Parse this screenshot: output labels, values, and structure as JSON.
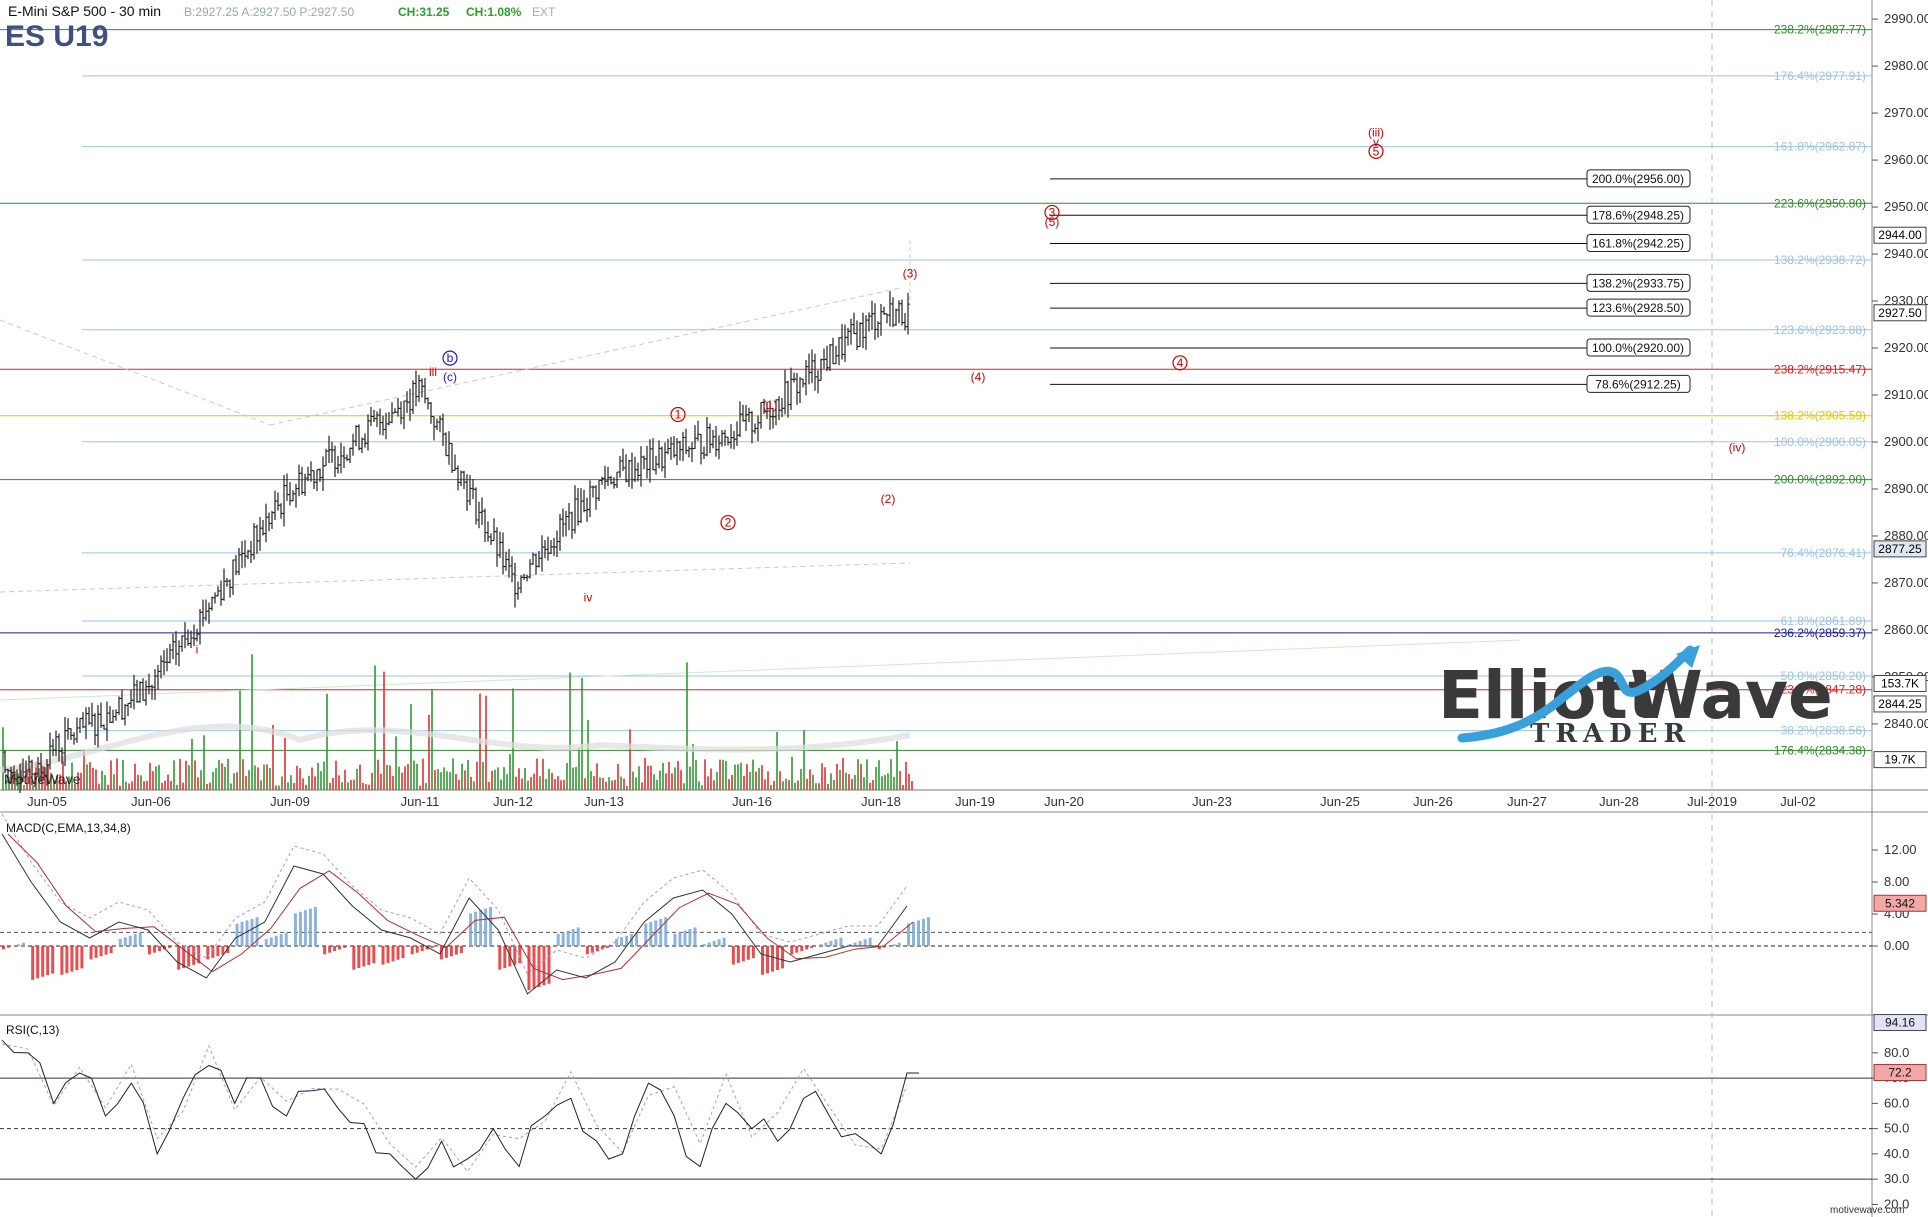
{
  "header": {
    "symbol_name": "E-Mini S&P 500 - 30 min",
    "quote": "B:2927.25 A:2927.50 P:2927.50",
    "change_abs": "CH:31.25",
    "change_pct": "CH:1.08%",
    "ext": "EXT",
    "ticker": "ES U19"
  },
  "branding": {
    "platform": "MotiveWave",
    "website": "motivewave.com",
    "logo_word1": "Elliott",
    "logo_word2": "Wave",
    "logo_sub": "TRADER"
  },
  "chart_data": [
    {
      "type": "line",
      "name": "price",
      "ylim": [
        2827,
        2993
      ],
      "y_ticks": [
        2840,
        2850,
        2860,
        2870,
        2880,
        2890,
        2900,
        2910,
        2920,
        2930,
        2940,
        2950,
        2960,
        2970,
        2980,
        2990
      ],
      "x_ticks": [
        "Jun-05",
        "Jun-06",
        "Jun-09",
        "Jun-11",
        "Jun-12",
        "Jun-13",
        "Jun-16",
        "Jun-18",
        "Jun-19",
        "Jun-20",
        "Jun-23",
        "Jun-25",
        "Jun-26",
        "Jun-27",
        "Jun-28",
        "Jul-2019",
        "Jul-02"
      ],
      "series": [
        {
          "x": [
            "Jun-05",
            "Jun-06",
            "Jun-09",
            "Jun-11",
            "Jun-12",
            "Jun-13",
            "Jun-16",
            "Jun-18"
          ],
          "values": [
            2834,
            2848,
            2890,
            2911,
            2870,
            2892,
            2904,
            2927.5
          ]
        }
      ],
      "price_badges": [
        {
          "value": "2944.00",
          "price": 2944.0,
          "color": "#ffffff",
          "text_color": "#000000"
        },
        {
          "value": "2927.50",
          "price": 2927.5,
          "color": "#ffffff",
          "text_color": "#000000"
        },
        {
          "value": "2877.25",
          "price": 2877.25,
          "color": "#dfe9f3",
          "text_color": "#000000"
        },
        {
          "value": "153.7K",
          "price": 2848.6,
          "color": "#ffffff",
          "text_color": "#000000"
        },
        {
          "value": "2844.25",
          "price": 2844.25,
          "color": "#ffffff",
          "text_color": "#000000"
        },
        {
          "value": "19.7K",
          "price": 2832.4,
          "color": "#ffffff",
          "text_color": "#000000"
        }
      ],
      "fib_levels": [
        {
          "label": "238.2%(2987.77)",
          "price": 2987.77,
          "color": "#2e8b2e"
        },
        {
          "label": "176.4%(2977.91)",
          "price": 2977.91,
          "color": "#9cc3e6"
        },
        {
          "label": "161.8%(2962.87)",
          "price": 2962.87,
          "color": "#9cc3e6"
        },
        {
          "label": "223.6%(2950.80)",
          "price": 2950.8,
          "color": "#2e8b2e"
        },
        {
          "label": "138.2%(2938.72)",
          "price": 2938.72,
          "color": "#9cc3e6"
        },
        {
          "label": "123.6%(2923.88)",
          "price": 2923.88,
          "color": "#9cc3e6"
        },
        {
          "label": "238.2%(2915.47)",
          "price": 2915.47,
          "color": "#e02020"
        },
        {
          "label": "138.2%(2905.59)",
          "price": 2905.59,
          "color": "#e6c800"
        },
        {
          "label": "100.0%(2900.05)",
          "price": 2900.05,
          "color": "#9cc3e6"
        },
        {
          "label": "200.0%(2892.00)",
          "price": 2892.0,
          "color": "#2e8b2e"
        },
        {
          "label": "76.4%(2876.41)",
          "price": 2876.41,
          "color": "#9cc3e6"
        },
        {
          "label": "61.8%(2861.89)",
          "price": 2861.89,
          "color": "#9cc3e6"
        },
        {
          "label": "236.2%(2859.37)",
          "price": 2859.37,
          "color": "#1a1aa0"
        },
        {
          "label": "50.0%(2850.20)",
          "price": 2850.2,
          "color": "#9cc3e6"
        },
        {
          "label": "223.6%(2847.28)",
          "price": 2847.28,
          "color": "#e02020"
        },
        {
          "label": "38.2%(2838.56)",
          "price": 2838.56,
          "color": "#9cc3e6"
        },
        {
          "label": "176.4%(2834.38)",
          "price": 2834.38,
          "color": "#2e8b2e"
        }
      ],
      "box_levels": [
        {
          "label": "200.0%(2956.00)",
          "price": 2956.0
        },
        {
          "label": "178.6%(2948.25)",
          "price": 2948.25
        },
        {
          "label": "161.8%(2942.25)",
          "price": 2942.25
        },
        {
          "label": "138.2%(2933.75)",
          "price": 2933.75
        },
        {
          "label": "123.6%(2928.50)",
          "price": 2928.5
        },
        {
          "label": "100.0%(2920.00)",
          "price": 2920.0
        },
        {
          "label": "78.6%(2912.25)",
          "price": 2912.25
        }
      ],
      "wave_labels": [
        {
          "text": "(iii)",
          "x": "Jun-25",
          "price": 2965,
          "color": "#cc0000"
        },
        {
          "text": "v",
          "x": "Jun-25",
          "price": 2963,
          "color": "#cc0000"
        },
        {
          "text": "5",
          "x": "Jun-25",
          "price": 2961,
          "color": "#cc0000",
          "circle": true
        },
        {
          "text": "3",
          "x": "Jun-20",
          "price": 2948,
          "color": "#cc0000",
          "circle": true
        },
        {
          "text": "(5)",
          "x": "Jun-20",
          "price": 2946,
          "color": "#cc0000"
        },
        {
          "text": "4",
          "x": "Jun-23",
          "price": 2916,
          "color": "#cc0000",
          "circle": true
        },
        {
          "text": "(4)",
          "x": "Jun-19",
          "price": 2913,
          "color": "#cc0000"
        },
        {
          "text": "(iv)",
          "x": "Jul-2019",
          "price": 2898,
          "color": "#cc0000"
        },
        {
          "text": "(3)",
          "x": "Jun-18",
          "price": 2935,
          "color": "#cc0000"
        },
        {
          "text": "(2)",
          "x": "Jun-18",
          "price": 2887,
          "color": "#cc0000"
        },
        {
          "text": "(1)",
          "x": "Jun-16",
          "price": 2907,
          "color": "#cc0000"
        },
        {
          "text": "1",
          "x": "Jun-13",
          "price": 2905,
          "color": "#cc0000",
          "circle": true
        },
        {
          "text": "2",
          "x": "Jun-13",
          "price": 2882,
          "color": "#cc0000",
          "circle": true
        },
        {
          "text": "iv",
          "x": "Jun-12",
          "price": 2866,
          "color": "#cc0000"
        },
        {
          "text": "iii",
          "x": "Jun-11",
          "price": 2914,
          "color": "#cc0000"
        },
        {
          "text": "b",
          "x": "Jun-11",
          "price": 2917,
          "color": "#1a1acc",
          "circle": true
        },
        {
          "text": "(c)",
          "x": "Jun-11",
          "price": 2913,
          "color": "#1a1acc"
        },
        {
          "text": "i",
          "x": "Jun-06",
          "price": 2855,
          "color": "#cc0000"
        }
      ]
    },
    {
      "type": "line",
      "name": "MACD(C,EMA,13,34,8)",
      "y_ticks": [
        "0.00",
        "4.00",
        "8.00",
        "12.00"
      ],
      "ylim": [
        -8,
        16
      ],
      "last_value": "5.342",
      "values": [
        14,
        8,
        3,
        1,
        3,
        2,
        -2,
        -4,
        1,
        3,
        10,
        9,
        5,
        2,
        1,
        -1,
        6,
        2,
        -6,
        -3,
        -4,
        -2,
        3,
        6,
        7,
        4,
        -1,
        -2,
        -1,
        0,
        0,
        5
      ]
    },
    {
      "type": "line",
      "name": "RSI(C,13)",
      "y_ticks": [
        "20.0",
        "30.0",
        "40.0",
        "50.0",
        "60.0",
        "70.0",
        "80.0"
      ],
      "ylim": [
        17,
        93
      ],
      "levels": [
        70,
        50,
        30
      ],
      "last_values": [
        "94.16",
        "72.2"
      ],
      "values": [
        85,
        80,
        60,
        72,
        55,
        68,
        40,
        62,
        75,
        60,
        70,
        55,
        65,
        58,
        52,
        40,
        30,
        45,
        38,
        50,
        35,
        55,
        62,
        45,
        40,
        68,
        55,
        35,
        60,
        50,
        45,
        62,
        55,
        48,
        40,
        72
      ]
    }
  ]
}
